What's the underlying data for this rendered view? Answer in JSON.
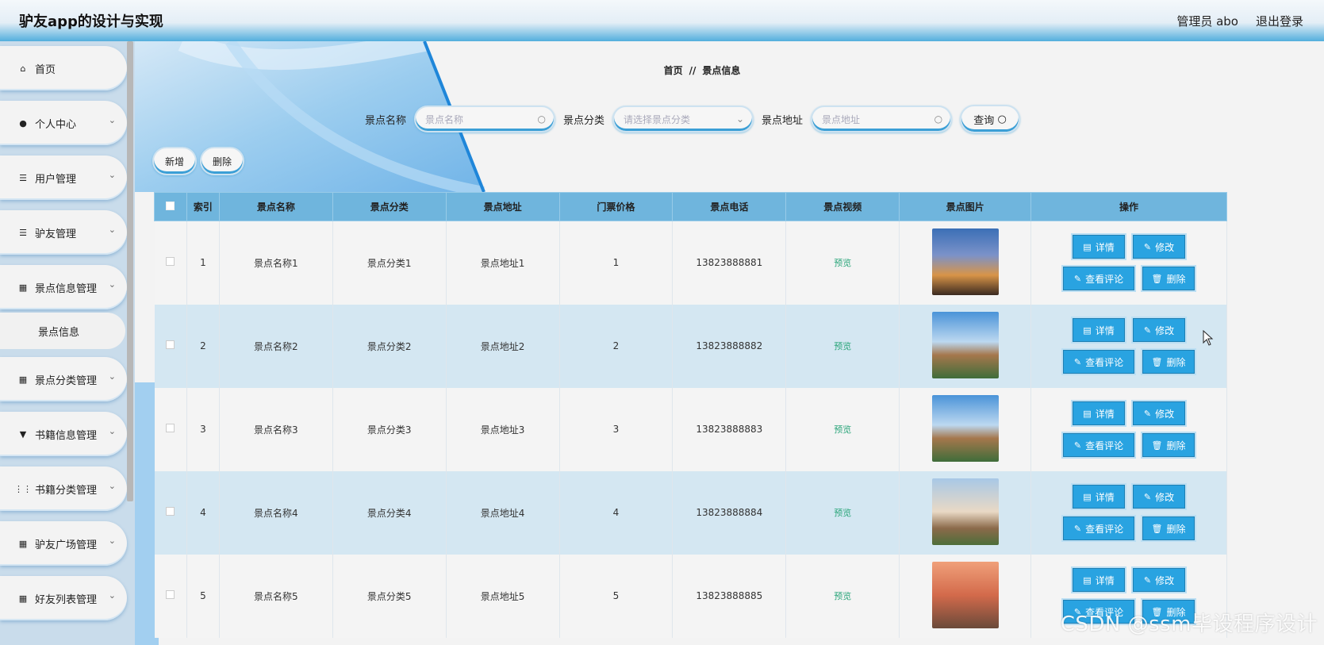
{
  "header": {
    "title": "驴友app的设计与实现",
    "user": "管理员 abo",
    "logout": "退出登录"
  },
  "sidebar": {
    "items": [
      {
        "label": "首页",
        "icon": "home-icon",
        "expandable": false
      },
      {
        "label": "个人中心",
        "icon": "user-icon",
        "expandable": true
      },
      {
        "label": "用户管理",
        "icon": "list-icon",
        "expandable": true
      },
      {
        "label": "驴友管理",
        "icon": "list-icon",
        "expandable": true
      },
      {
        "label": "景点信息管理",
        "icon": "grid-icon",
        "expandable": true
      },
      {
        "label": "景点信息",
        "icon": "",
        "expandable": false
      },
      {
        "label": "景点分类管理",
        "icon": "grid-icon",
        "expandable": true
      },
      {
        "label": "书籍信息管理",
        "icon": "pin-icon",
        "expandable": true
      },
      {
        "label": "书籍分类管理",
        "icon": "apps-icon",
        "expandable": true
      },
      {
        "label": "驴友广场管理",
        "icon": "grid-icon",
        "expandable": true
      },
      {
        "label": "好友列表管理",
        "icon": "grid-icon",
        "expandable": true
      }
    ]
  },
  "breadcrumb": {
    "home": "首页",
    "separator": "//",
    "current": "景点信息"
  },
  "search": {
    "name_label": "景点名称",
    "name_placeholder": "景点名称",
    "category_label": "景点分类",
    "category_placeholder": "请选择景点分类",
    "address_label": "景点地址",
    "address_placeholder": "景点地址",
    "query_label": "查询"
  },
  "actions": {
    "add": "新增",
    "delete": "删除"
  },
  "table": {
    "columns": [
      "索引",
      "景点名称",
      "景点分类",
      "景点地址",
      "门票价格",
      "景点电话",
      "景点视频",
      "景点图片",
      "操作"
    ],
    "preview_label": "预览",
    "op_labels": {
      "detail": "详情",
      "edit": "修改",
      "comments": "查看评论",
      "delete": "删除"
    },
    "rows": [
      {
        "index": "1",
        "name": "景点名称1",
        "category": "景点分类1",
        "address": "景点地址1",
        "price": "1",
        "phone": "13823888881"
      },
      {
        "index": "2",
        "name": "景点名称2",
        "category": "景点分类2",
        "address": "景点地址2",
        "price": "2",
        "phone": "13823888882"
      },
      {
        "index": "3",
        "name": "景点名称3",
        "category": "景点分类3",
        "address": "景点地址3",
        "price": "3",
        "phone": "13823888883"
      },
      {
        "index": "4",
        "name": "景点名称4",
        "category": "景点分类4",
        "address": "景点地址4",
        "price": "4",
        "phone": "13823888884"
      },
      {
        "index": "5",
        "name": "景点名称5",
        "category": "景点分类5",
        "address": "景点地址5",
        "price": "5",
        "phone": "13823888885"
      }
    ]
  },
  "watermark": "CSDN @ssm毕设程序设计",
  "colors": {
    "accent": "#29a3e1",
    "header_row": "#6fb5dd",
    "alt_row": "#d4e7f2"
  }
}
